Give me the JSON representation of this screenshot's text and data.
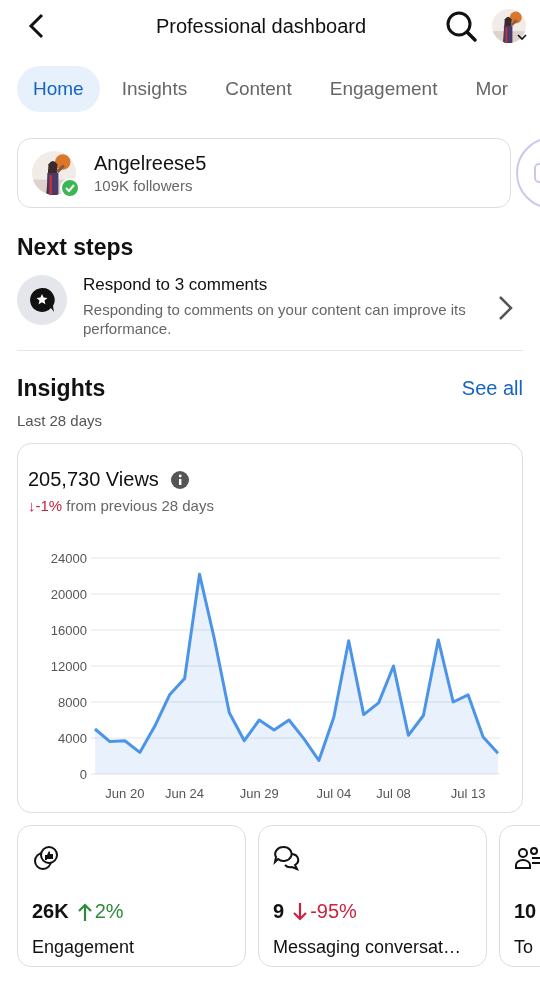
{
  "header": {
    "title": "Professional dashboard"
  },
  "tabs": [
    {
      "label": "Home",
      "selected": true
    },
    {
      "label": "Insights",
      "selected": false
    },
    {
      "label": "Content",
      "selected": false
    },
    {
      "label": "Engagement",
      "selected": false
    },
    {
      "label": "Mor",
      "selected": false
    }
  ],
  "profile": {
    "name": "Angelreese5",
    "followers": "109K followers",
    "verified": true
  },
  "next_steps": {
    "title": "Next steps",
    "items": [
      {
        "title": "Respond to 3 comments",
        "description": "Responding to comments on your content can improve its performance."
      }
    ]
  },
  "insights": {
    "title": "Insights",
    "link": "See all",
    "period": "Last 28 days",
    "views": {
      "title": "205,730 Views",
      "change": "↓-1%",
      "change_note": "from previous 28 days",
      "chart_data": {
        "type": "area",
        "categories": [
          null,
          null,
          "Jun 20",
          null,
          null,
          null,
          "Jun 24",
          null,
          null,
          null,
          null,
          "Jun 29",
          null,
          null,
          null,
          null,
          "Jul 04",
          null,
          null,
          null,
          "Jul 08",
          null,
          null,
          null,
          null,
          "Jul 13",
          null,
          null
        ],
        "series": [
          {
            "color": "#4c94e8",
            "values": [
              5000,
              3600,
              3700,
              2400,
              5300,
              8800,
              10600,
              22200,
              15000,
              6800,
              3700,
              6000,
              4900,
              6000,
              3900,
              1500,
              6300,
              14800,
              6600,
              7900,
              12000,
              4300,
              6500,
              14900,
              8000,
              8800,
              4100,
              2300
            ]
          }
        ],
        "ylim": [
          0,
          24000
        ],
        "grid": true,
        "yticks": [
          0,
          4000,
          8000,
          12000,
          16000,
          20000,
          24000
        ]
      }
    },
    "metrics": [
      {
        "kind": "engagement",
        "value": "26K",
        "increase": true,
        "change": "2%",
        "label": "Engagement"
      },
      {
        "kind": "messages",
        "value": "9",
        "increase": false,
        "change": "-95%",
        "label": "Messaging conversat…"
      },
      {
        "kind": "followers",
        "value": "10",
        "label": "To"
      }
    ]
  }
}
